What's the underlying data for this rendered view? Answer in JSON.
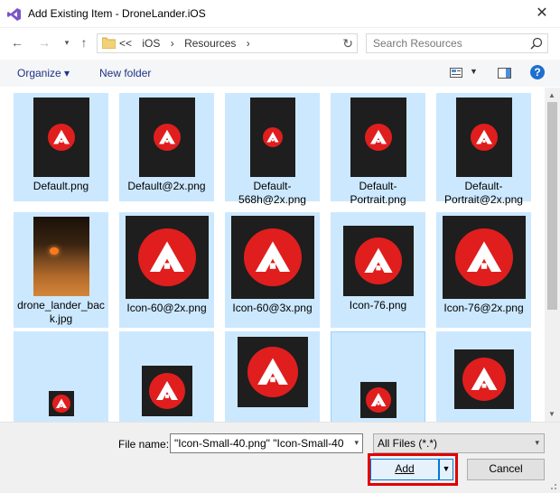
{
  "window": {
    "title": "Add Existing Item - DroneLander.iOS"
  },
  "nav": {
    "breadcrumb": [
      "<<",
      "iOS",
      "›",
      "Resources",
      "›"
    ],
    "search_placeholder": "Search Resources"
  },
  "toolbar": {
    "organize": "Organize ▾",
    "new_folder": "New folder",
    "help": "?"
  },
  "files": [
    {
      "name": "Default.png",
      "kind": "portrait"
    },
    {
      "name": "Default@2x.png",
      "kind": "portrait"
    },
    {
      "name": "Default-568h@2x.png",
      "kind": "portrait-small"
    },
    {
      "name": "Default-Portrait.png",
      "kind": "portrait"
    },
    {
      "name": "Default-Portrait@2x.png",
      "kind": "portrait"
    },
    {
      "name": "drone_lander_back.jpg",
      "kind": "photo"
    },
    {
      "name": "Icon-60@2x.png",
      "kind": "icon-large"
    },
    {
      "name": "Icon-60@3x.png",
      "kind": "icon-large"
    },
    {
      "name": "Icon-76.png",
      "kind": "icon-medium"
    },
    {
      "name": "Icon-76@2x.png",
      "kind": "icon-large"
    },
    {
      "name": "",
      "kind": "icon-tiny"
    },
    {
      "name": "",
      "kind": "icon-small"
    },
    {
      "name": "",
      "kind": "icon-medium2"
    },
    {
      "name": "",
      "kind": "icon-small2"
    },
    {
      "name": "",
      "kind": "icon-medium3"
    }
  ],
  "bottom": {
    "file_name_label": "File name:",
    "file_name_value": "\"Icon-Small-40.png\" \"Icon-Small-40",
    "filter_value": "All Files (*.*)",
    "add_label": "Add",
    "cancel_label": "Cancel"
  },
  "colors": {
    "accent": "#0078d7",
    "selection": "#cce8ff",
    "logo_red": "#e01e1e",
    "highlight_box": "#e00000"
  }
}
